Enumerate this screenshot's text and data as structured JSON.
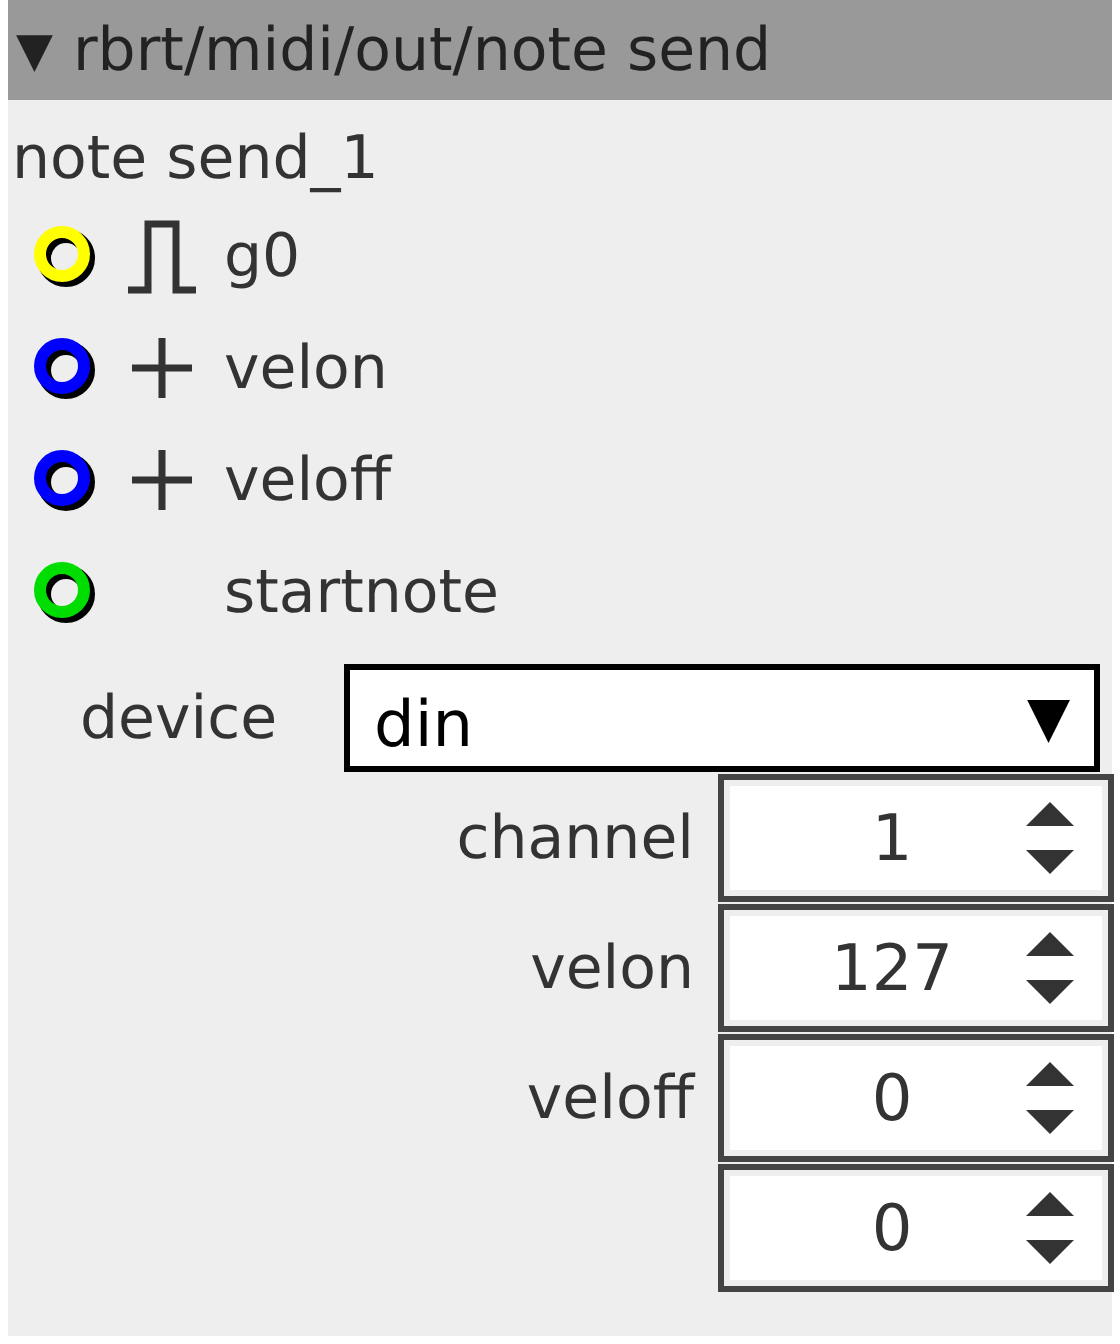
{
  "header": {
    "toggle": "▼",
    "title": "rbrt/midi/out/note send"
  },
  "node_name": "note send_1",
  "ports": [
    {
      "color": "#ffff00",
      "kind": "gate",
      "label": "g0"
    },
    {
      "color": "#0000ff",
      "kind": "plus",
      "label": "velon"
    },
    {
      "color": "#0000ff",
      "kind": "plus",
      "label": "veloff"
    },
    {
      "color": "#00dd00",
      "kind": "none",
      "label": "startnote"
    }
  ],
  "device": {
    "label": "device",
    "value": "din",
    "caret": "▼"
  },
  "params": [
    {
      "label": "channel",
      "value": "1"
    },
    {
      "label": "velon",
      "value": "127"
    },
    {
      "label": "veloff",
      "value": "0"
    },
    {
      "value": "0"
    }
  ]
}
